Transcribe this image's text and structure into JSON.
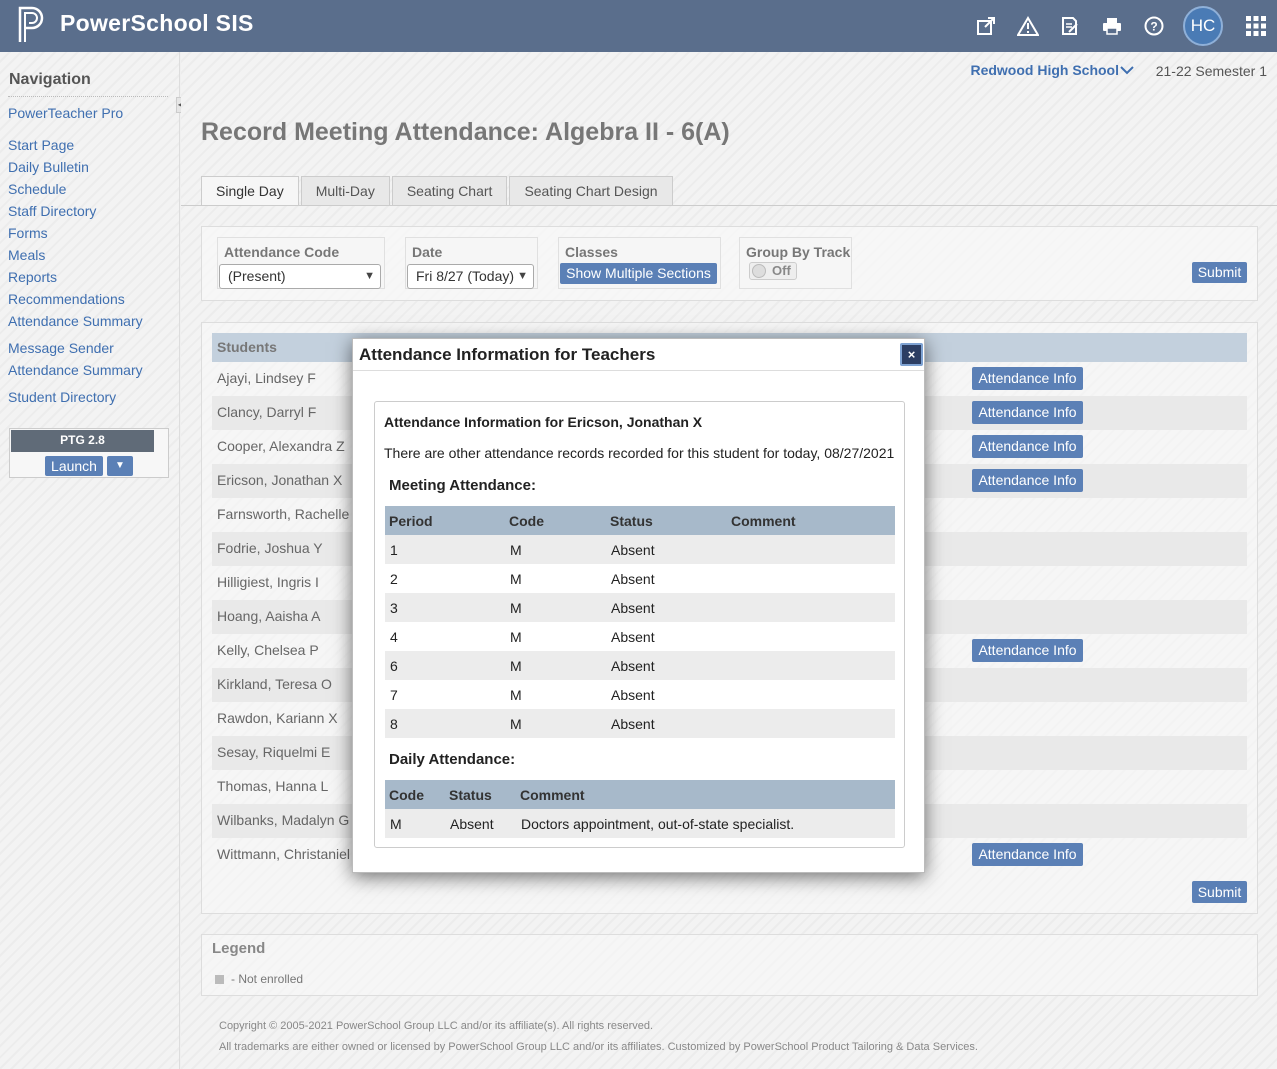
{
  "header": {
    "brand": "PowerSchool SIS",
    "avatar_initials": "HC",
    "icons": [
      "external-link-icon",
      "warning-icon",
      "edit-document-icon",
      "printer-icon",
      "help-icon",
      "app-grid-icon"
    ]
  },
  "nav": {
    "title": "Navigation",
    "links": [
      "PowerTeacher Pro",
      "Start Page",
      "Daily Bulletin",
      "Schedule",
      "Staff Directory",
      "Forms",
      "Meals",
      "Reports",
      "Recommendations",
      "Attendance Summary",
      "Message Sender",
      "Attendance Summary",
      "Student Directory"
    ],
    "ptg": {
      "title": "PTG 2.8",
      "launch": "Launch",
      "dropdown": "▼"
    }
  },
  "context": {
    "school": "Redwood High School",
    "term": "21-22 Semester 1"
  },
  "page_title": "Record Meeting Attendance: Algebra II - 6(A)",
  "tabs": [
    "Single Day",
    "Multi-Day",
    "Seating Chart",
    "Seating Chart Design"
  ],
  "filters": {
    "attendance_code_label": "Attendance Code",
    "attendance_code_value": "(Present)",
    "date_label": "Date",
    "date_value": "Fri 8/27 (Today)",
    "classes_label": "Classes",
    "classes_button": "Show Multiple Sections",
    "group_label": "Group By Track",
    "group_toggle": "Off",
    "submit": "Submit"
  },
  "students": {
    "header": "Students",
    "info_button": "Attendance Info",
    "rows": [
      {
        "name": "Ajayi, Lindsey F",
        "has_info": true
      },
      {
        "name": "Clancy, Darryl F",
        "has_info": true
      },
      {
        "name": "Cooper, Alexandra Z",
        "has_info": true
      },
      {
        "name": "Ericson, Jonathan X",
        "has_info": true
      },
      {
        "name": "Farnsworth, Rachelle",
        "has_info": false
      },
      {
        "name": "Fodrie, Joshua Y",
        "has_info": false
      },
      {
        "name": "Hilligiest, Ingris I",
        "has_info": false
      },
      {
        "name": "Hoang, Aaisha A",
        "has_info": false
      },
      {
        "name": "Kelly, Chelsea P",
        "has_info": true
      },
      {
        "name": "Kirkland, Teresa O",
        "has_info": false
      },
      {
        "name": "Rawdon, Kariann X",
        "has_info": false
      },
      {
        "name": "Sesay, Riquelmi E",
        "has_info": false
      },
      {
        "name": "Thomas, Hanna L",
        "has_info": false
      },
      {
        "name": "Wilbanks, Madalyn G",
        "has_info": false
      },
      {
        "name": "Wittmann, Christaniel",
        "has_info": true
      }
    ],
    "submit": "Submit"
  },
  "legend": {
    "title": "Legend",
    "item": "- Not enrolled"
  },
  "footer": {
    "line1": "Copyright © 2005-2021 PowerSchool Group LLC and/or its affiliate(s). All rights reserved.",
    "line2": "All trademarks are either owned or licensed by PowerSchool Group LLC and/or its affiliates. Customized by PowerSchool Product Tailoring & Data Services."
  },
  "modal": {
    "title": "Attendance Information for Teachers",
    "close": "×",
    "inner_title": "Attendance Information for Ericson, Jonathan X",
    "message": "There are other attendance records recorded for this student for today, 08/27/2021",
    "meeting_title": "Meeting Attendance:",
    "meeting_headers": [
      "Period",
      "Code",
      "Status",
      "Comment"
    ],
    "meeting_rows": [
      [
        "1",
        "M",
        "Absent",
        ""
      ],
      [
        "2",
        "M",
        "Absent",
        ""
      ],
      [
        "3",
        "M",
        "Absent",
        ""
      ],
      [
        "4",
        "M",
        "Absent",
        ""
      ],
      [
        "6",
        "M",
        "Absent",
        ""
      ],
      [
        "7",
        "M",
        "Absent",
        ""
      ],
      [
        "8",
        "M",
        "Absent",
        ""
      ]
    ],
    "daily_title": "Daily Attendance:",
    "daily_headers": [
      "Code",
      "Status",
      "Comment"
    ],
    "daily_rows": [
      [
        "M",
        "Absent",
        "Doctors appointment, out-of-state specialist."
      ]
    ]
  }
}
